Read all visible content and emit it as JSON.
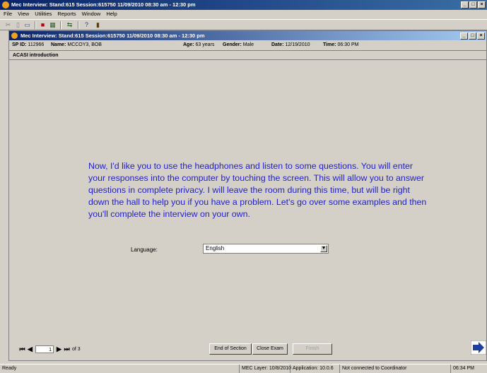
{
  "app": {
    "title": "Mec Interview: Stand:615 Session:615750 11/09/2010 08:30 am - 12:30 pm",
    "menu": [
      "File",
      "View",
      "Utilities",
      "Reports",
      "Window",
      "Help"
    ]
  },
  "child": {
    "title": "Mec Interview: Stand:615 Session:615750 11/09/2010 08:30 am - 12:30 pm",
    "sp_id_label": "SP ID:",
    "sp_id": "112966",
    "name_label": "Name:",
    "name": "MCCOY3, BOB",
    "age_label": "Age:",
    "age": "63 years",
    "gender_label": "Gender:",
    "gender": "Male",
    "date_label": "Date:",
    "date": "12/19/2010",
    "time_label": "Time:",
    "time": "06:30 PM",
    "section": "ACASI introduction"
  },
  "main": {
    "prompt": "Now, I'd like you to use the headphones and listen to some questions. You will enter your responses into the computer by touching the screen. This will allow you to answer questions in complete privacy. I will leave the room during this time, but will be right down the hall to help you if you have a problem. Let's go over some examples and then you'll complete the interview on your own.",
    "language_label": "Language:",
    "language_value": "English"
  },
  "footer": {
    "page": "1",
    "of_pages": "of 3",
    "end_section": "End of Section",
    "close_exam": "Close Exam",
    "finish": "Finish"
  },
  "status": {
    "ready": "Ready",
    "mec_layer": "MEC Layer: 10/8/2010",
    "application": "Application: 10.0.6",
    "connection": "Not connected to Coordinator",
    "clock": "06:34 PM"
  },
  "colors": {
    "prompt": "#1f1fd0",
    "title_start": "#0a246a",
    "title_end": "#3a6ea5"
  }
}
